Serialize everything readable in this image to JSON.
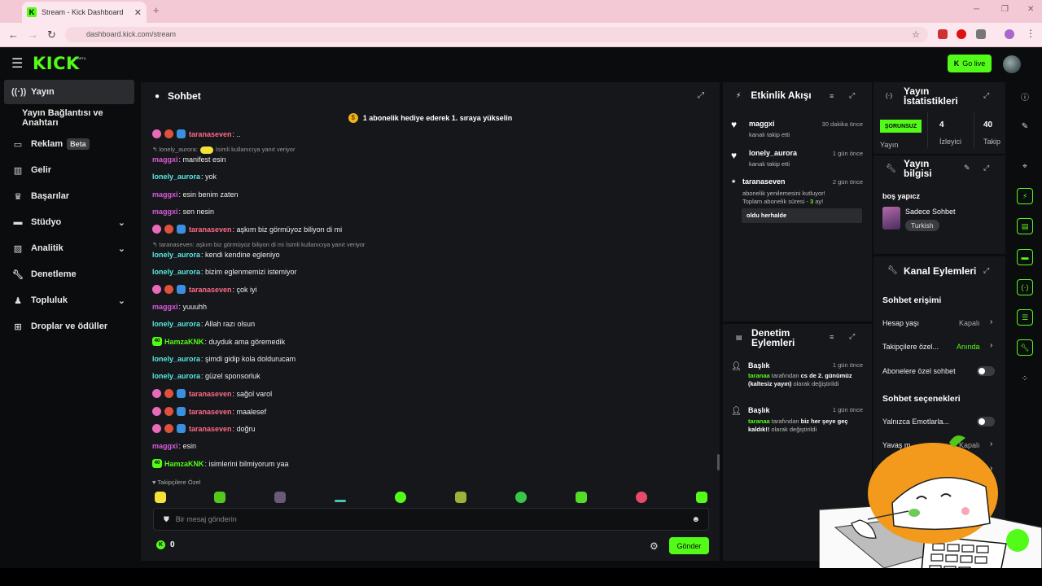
{
  "browser": {
    "tab_title": "Stream - Kick Dashboard",
    "url": "dashboard.kick.com/stream"
  },
  "topbar": {
    "logo": "KICK",
    "logo_badge": "BETA",
    "go_live": "Go live"
  },
  "sidebar": {
    "items": [
      {
        "label": "Yayın",
        "icon": "broadcast-icon"
      },
      {
        "label": "Yayın Bağlantısı ve Anahtarı",
        "icon": ""
      },
      {
        "label": "Reklam",
        "icon": "ad-icon",
        "badge": "Beta"
      },
      {
        "label": "Gelir",
        "icon": "chart-icon"
      },
      {
        "label": "Başarılar",
        "icon": "trophy-icon"
      },
      {
        "label": "Stüdyo",
        "icon": "studio-icon"
      },
      {
        "label": "Analitik",
        "icon": "analytics-icon"
      },
      {
        "label": "Denetleme",
        "icon": "wrench-icon"
      },
      {
        "label": "Topluluk",
        "icon": "community-icon"
      },
      {
        "label": "Droplar ve ödüller",
        "icon": "drops-icon"
      }
    ]
  },
  "chat": {
    "title": "Sohbet",
    "pinned": "1 abonelik hediye ederek 1. sıraya yükselin",
    "reply1_user": "lonely_aurora:",
    "reply1_text": "İsimli kullanıcıya yanıt veriyor",
    "reply2": "taranaseven: aşkım biz görmüyoz biliyon di mi İsimli kullanıcıya yanıt veriyor",
    "messages": [
      {
        "user": "taranaseven",
        "text": ": .."
      },
      {
        "user": "maggxi",
        "text": ": manifest esin"
      },
      {
        "user": "lonely_aurora",
        "text": ": yok"
      },
      {
        "user": "maggxi",
        "text": ": esin benim zaten"
      },
      {
        "user": "maggxi",
        "text": ": sen nesin"
      },
      {
        "user": "taranaseven",
        "text": ": aşkım biz görmüyoz biliyon di mi"
      },
      {
        "user": "lonely_aurora",
        "text": ": kendi kendine egleniyo"
      },
      {
        "user": "lonely_aurora",
        "text": ": bizim eglenmemizi istemiyor"
      },
      {
        "user": "taranaseven",
        "text": ": çok iyi"
      },
      {
        "user": "maggxi",
        "text": ": yuuuhh"
      },
      {
        "user": "lonely_aurora",
        "text": ": Allah razı olsun"
      },
      {
        "user": "HamzaKNK",
        "text": ": duyduk ama göremedik"
      },
      {
        "user": "lonely_aurora",
        "text": ": şimdi gidip kola doldurucam"
      },
      {
        "user": "lonely_aurora",
        "text": ": güzel sponsorluk"
      },
      {
        "user": "taranaseven",
        "text": ": sağol varol"
      },
      {
        "user": "taranaseven",
        "text": ": maalesef"
      },
      {
        "user": "taranaseven",
        "text": ": doğru"
      },
      {
        "user": "maggxi",
        "text": ": esin"
      },
      {
        "user": "HamzaKNK",
        "text": ": isimlerini bilmiyorum yaa"
      }
    ],
    "followers_only": "Takipçilere Özel",
    "input_placeholder": "Bir mesaj gönderin",
    "points": "0",
    "send": "Gönder"
  },
  "activity": {
    "title": "Etkinlik Akışı",
    "events": [
      {
        "name": "maggxi",
        "sub": "kanalı takip etti",
        "time": "30 dakika önce"
      },
      {
        "name": "lonely_aurora",
        "sub": "kanalı takip etti",
        "time": "1 gün önce"
      },
      {
        "name": "taranaseven",
        "sub1": "abonelik yenilemesini kutluyor!",
        "sub2a": "Toplam abonelik süresi - ",
        "sub2b": "3",
        "sub2c": " ay!",
        "time": "2 gün önce",
        "quote": "oldu herhalde"
      }
    ]
  },
  "modlog": {
    "title_1": "Denetim",
    "title_2": "Eylemleri",
    "entries": [
      {
        "title": "Başlık",
        "time": "1 gün önce",
        "who": "taranaa",
        "mid": " tarafından ",
        "what": "cs de 2. günümüz (kaltesiz yayın)",
        "end": " olarak değiştirildi"
      },
      {
        "title": "Başlık",
        "time": "1 gün önce",
        "who": "taranaa",
        "mid": " tarafından ",
        "what": "biz her şeye geç kaldık!!",
        "end": " olarak değiştirildi"
      }
    ]
  },
  "stats": {
    "title_1": "Yayın",
    "title_2": "İstatistikleri",
    "status": "ŞORUNSUZ",
    "status_label": "Yayın",
    "viewers": "4",
    "viewers_label": "İzleyici",
    "followers": "40",
    "followers_label": "Takip"
  },
  "info": {
    "title_1": "Yayın",
    "title_2": "bilgisi",
    "stream_title": "boş yapıcz",
    "category": "Sadece Sohbet",
    "language": "Turkish"
  },
  "actions": {
    "title": "Kanal Eylemleri",
    "access_header": "Sohbet erişimi",
    "account_age": "Hesap yaşı",
    "account_age_val": "Kapalı",
    "followers_only": "Takipçilere özel...",
    "followers_only_val": "Anında",
    "subs_only": "Abonelere özel sohbet",
    "options_header": "Sohbet seçenekleri",
    "emotes_only": "Yalnızca Emotlarla...",
    "slow_mode": "Yavaş m",
    "slow_mode_val": "Kapalı",
    "partial": "Ya"
  },
  "colors": {
    "accent": "#53fc18",
    "panel": "#16171a",
    "background": "#0b0c0d"
  }
}
